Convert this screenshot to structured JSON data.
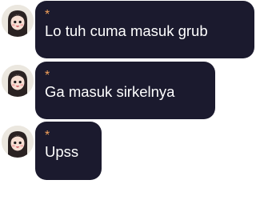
{
  "messages": [
    {
      "sender": "*",
      "text": "Lo tuh cuma masuk grub",
      "avatar_icon": "girl-avatar-icon"
    },
    {
      "sender": "*",
      "text": "Ga masuk sirkelnya",
      "avatar_icon": "girl-avatar-icon"
    },
    {
      "sender": "*",
      "text": "Upss",
      "avatar_icon": "girl-avatar-icon"
    }
  ],
  "colors": {
    "bubble": "#1b1a2e",
    "sender": "#f2a05a",
    "text": "#ffffff"
  }
}
